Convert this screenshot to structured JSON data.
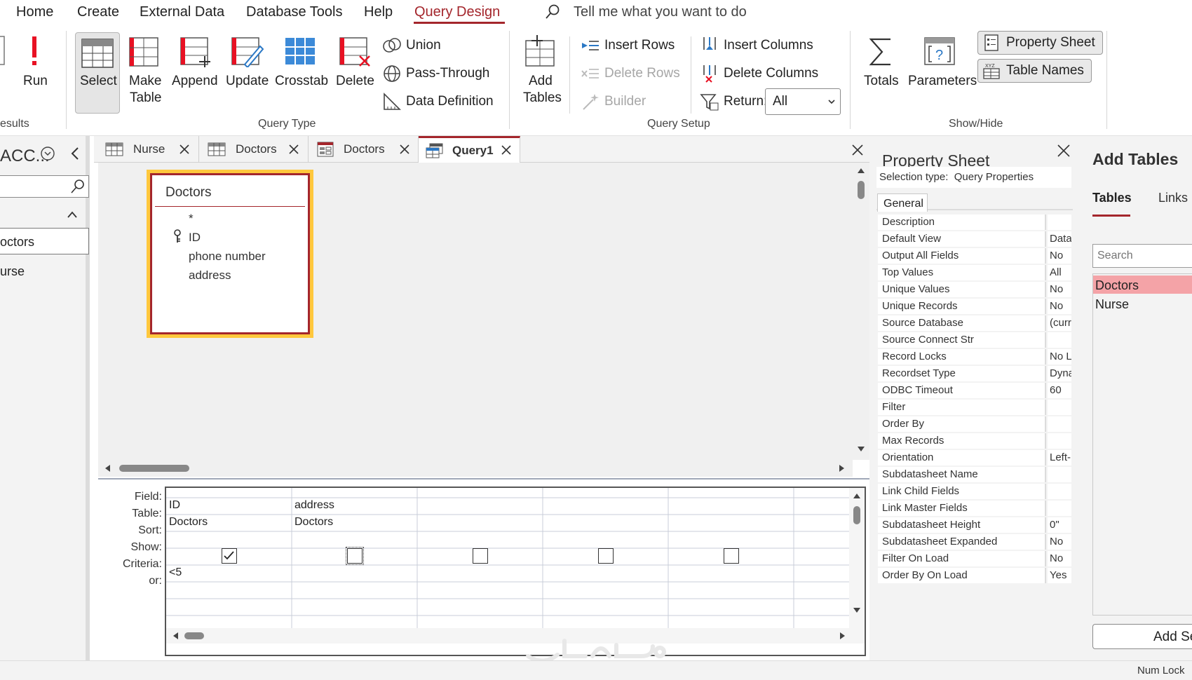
{
  "menu": {
    "items": [
      "Home",
      "Create",
      "External Data",
      "Database Tools",
      "Help",
      "Query Design"
    ],
    "active": "Query Design",
    "tell_me": "Tell me what you want to do"
  },
  "ribbon": {
    "results": {
      "run_label": "Run",
      "group_label": "esults"
    },
    "query_type": {
      "select": "Select",
      "make_table": [
        "Make",
        "Table"
      ],
      "append": "Append",
      "update": "Update",
      "crosstab": "Crosstab",
      "delete": "Delete",
      "union": "Union",
      "pass_through": "Pass-Through",
      "data_definition": "Data Definition",
      "group_label": "Query Type"
    },
    "query_setup": {
      "add_tables": [
        "Add",
        "Tables"
      ],
      "insert_rows": "Insert Rows",
      "delete_rows": "Delete Rows",
      "builder": "Builder",
      "insert_columns": "Insert Columns",
      "delete_columns": "Delete Columns",
      "return_label": "Return:",
      "return_value": "All",
      "group_label": "Query Setup"
    },
    "show_hide": {
      "totals": "Totals",
      "parameters": "Parameters",
      "property_sheet": "Property Sheet",
      "table_names": "Table Names",
      "group_label": "Show/Hide"
    }
  },
  "nav": {
    "title": "ACC...",
    "items": [
      "octors",
      "urse"
    ]
  },
  "tabs": [
    {
      "label": "Nurse",
      "icon": "table-icon"
    },
    {
      "label": "Doctors",
      "icon": "table-icon"
    },
    {
      "label": "Doctors",
      "icon": "form-icon"
    },
    {
      "label": "Query1",
      "icon": "query-icon"
    }
  ],
  "field_list": {
    "title": "Doctors",
    "fields": [
      "*",
      "ID",
      "phone number",
      "address"
    ],
    "key_field": "ID"
  },
  "query_grid": {
    "row_labels": [
      "Field:",
      "Table:",
      "Sort:",
      "Show:",
      "Criteria:",
      "or:"
    ],
    "columns": [
      {
        "field": "ID",
        "table": "Doctors",
        "sort": "",
        "show": true,
        "criteria": "<5"
      },
      {
        "field": "address",
        "table": "Doctors",
        "sort": "",
        "show": false,
        "criteria": ""
      },
      {
        "field": "",
        "table": "",
        "sort": "",
        "show": false,
        "criteria": ""
      },
      {
        "field": "",
        "table": "",
        "sort": "",
        "show": false,
        "criteria": ""
      },
      {
        "field": "",
        "table": "",
        "sort": "",
        "show": false,
        "criteria": ""
      }
    ]
  },
  "property_sheet": {
    "title": "Property Sheet",
    "selection_type": "Selection type:  Query Properties",
    "tab": "General",
    "rows": [
      {
        "name": "Description",
        "value": ""
      },
      {
        "name": "Default View",
        "value": "Data"
      },
      {
        "name": "Output All Fields",
        "value": "No"
      },
      {
        "name": "Top Values",
        "value": "All"
      },
      {
        "name": "Unique Values",
        "value": "No"
      },
      {
        "name": "Unique Records",
        "value": "No"
      },
      {
        "name": "Source Database",
        "value": "(curr"
      },
      {
        "name": "Source Connect Str",
        "value": ""
      },
      {
        "name": "Record Locks",
        "value": "No L"
      },
      {
        "name": "Recordset Type",
        "value": "Dyna"
      },
      {
        "name": "ODBC Timeout",
        "value": "60"
      },
      {
        "name": "Filter",
        "value": ""
      },
      {
        "name": "Order By",
        "value": ""
      },
      {
        "name": "Max Records",
        "value": ""
      },
      {
        "name": "Orientation",
        "value": "Left-"
      },
      {
        "name": "Subdatasheet Name",
        "value": ""
      },
      {
        "name": "Link Child Fields",
        "value": ""
      },
      {
        "name": "Link Master Fields",
        "value": ""
      },
      {
        "name": "Subdatasheet Height",
        "value": "0\""
      },
      {
        "name": "Subdatasheet Expanded",
        "value": "No"
      },
      {
        "name": "Filter On Load",
        "value": "No"
      },
      {
        "name": "Order By On Load",
        "value": "Yes"
      }
    ]
  },
  "add_tables": {
    "title": "Add Tables",
    "tabs": [
      "Tables",
      "Links"
    ],
    "search_placeholder": "Search",
    "items": [
      "Doctors",
      "Nurse"
    ],
    "selected": "Doctors",
    "add_button": "Add Se"
  },
  "status": {
    "num_lock": "Num Lock"
  },
  "colors": {
    "accent": "#a4262c",
    "highlight": "#ffc83d",
    "selected_row": "#f4a3a7"
  }
}
